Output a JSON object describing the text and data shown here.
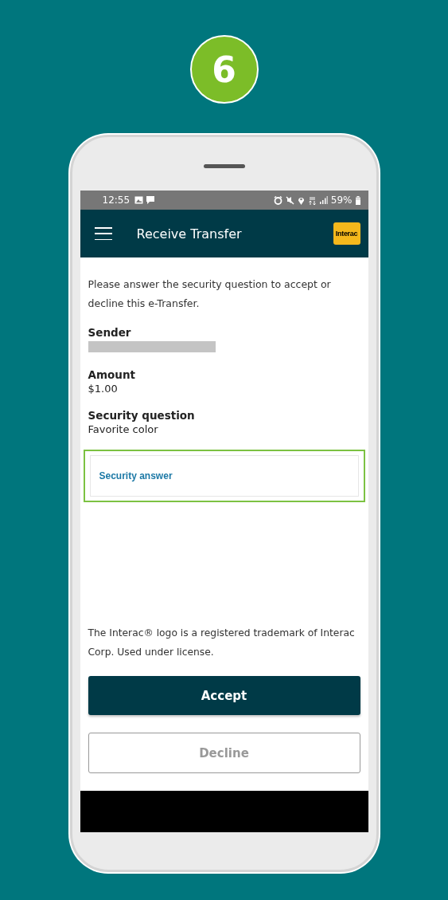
{
  "step_badge": "6",
  "status_bar": {
    "time": "12:55",
    "battery": "59%"
  },
  "app_bar": {
    "title": "Receive Transfer",
    "logo_text": "Interac"
  },
  "intro": "Please answer the security question to accept or decline this e-Transfer.",
  "details": [
    {
      "label": "Sender",
      "kind": "redacted"
    },
    {
      "label": "Amount",
      "kind": "text",
      "value": "$1.00"
    },
    {
      "label": "Security question",
      "kind": "text",
      "value": "Favorite color"
    }
  ],
  "answer_field": {
    "placeholder": "Security answer",
    "highlighted": true
  },
  "disclaimer": "The Interac® logo is a registered trademark of Interac Corp. Used under license.",
  "buttons": [
    {
      "label": "Accept",
      "kind": "primary",
      "disabled": false
    },
    {
      "label": "Decline",
      "kind": "secondary",
      "disabled": true
    }
  ]
}
